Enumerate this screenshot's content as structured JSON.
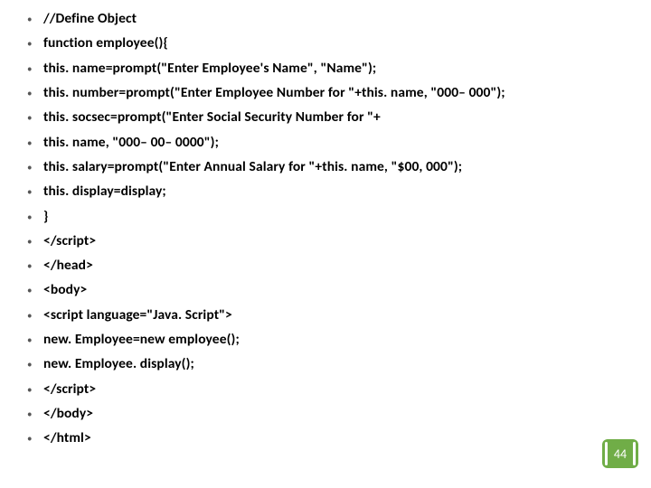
{
  "slide": {
    "lines": [
      "//Define Object",
      "function employee(){",
      "this. name=prompt(\"Enter Employee's Name\", \"Name\");",
      "this. number=prompt(\"Enter Employee Number for \"+this. name, \"000– 000\");",
      "this. socsec=prompt(\"Enter Social Security Number for \"+",
      "this. name, \"000– 00– 0000\");",
      "this. salary=prompt(\"Enter Annual Salary for \"+this. name, \"$00, 000\");",
      "this. display=display;",
      "}",
      "</script>",
      "</head>",
      "<body>",
      "<script language=\"Java. Script\">",
      "new. Employee=new employee();",
      "new. Employee. display();",
      "</script>",
      "</body>",
      "</html>"
    ],
    "pageNumber": "44"
  }
}
